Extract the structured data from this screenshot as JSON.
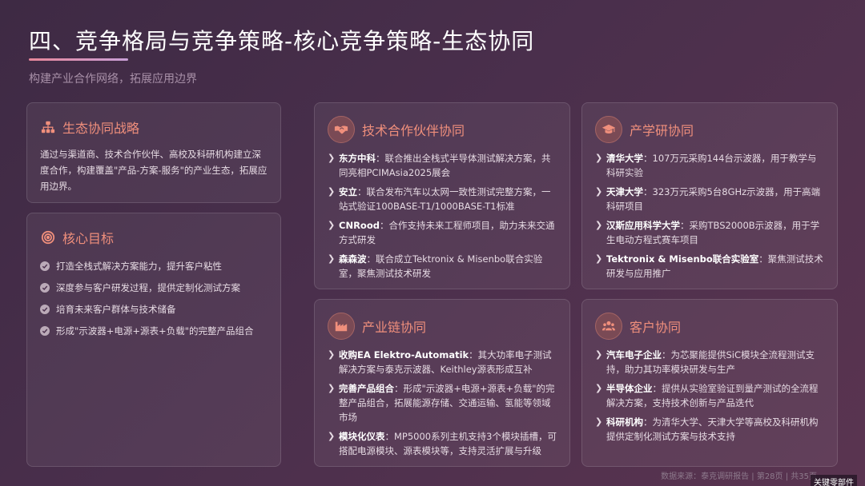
{
  "header": {
    "title": "四、竞争格局与竞争策略-核心竞争策略-生态协同",
    "subtitle": "构建产业合作网络，拓展应用边界"
  },
  "colors": {
    "accent": "#f08f7c",
    "background": "#4a2f4c"
  },
  "strategy": {
    "title": "生态协同战略",
    "icon": "sitemap-icon",
    "description": "通过与渠道商、技术合作伙伴、高校及科研机构建立深度合作，构建覆盖\"产品-方案-服务\"的产业生态，拓展应用边界。"
  },
  "goals": {
    "title": "核心目标",
    "icon": "target-icon",
    "items": [
      "打造全栈式解决方案能力，提升客户粘性",
      "深度参与客户研发过程，提供定制化测试方案",
      "培育未来客户群体与技术储备",
      "形成\"示波器+电源+源表+负载\"的完整产品组合"
    ]
  },
  "tech_partners": {
    "title": "技术合作伙伴协同",
    "icon": "handshake-icon",
    "items": [
      {
        "lead": "东方中科",
        "text": "：联合推出全栈式半导体测试解决方案，共同亮相PCIMAsia2025展会"
      },
      {
        "lead": "安立",
        "text": "：联合发布汽车以太网一致性测试完整方案，一站式验证100BASE-T1/1000BASE-T1标准"
      },
      {
        "lead": "CNRood",
        "text": "：合作支持未来工程师项目，助力未来交通方式研发"
      },
      {
        "lead": "森森波",
        "text": "：联合成立Tektronix & Misenbo联合实验室，聚焦测试技术研发"
      }
    ]
  },
  "academia": {
    "title": "产学研协同",
    "icon": "graduation-cap-icon",
    "items": [
      {
        "lead": "清华大学",
        "text": "：107万元采购144台示波器，用于教学与科研实验"
      },
      {
        "lead": "天津大学",
        "text": "：323万元采购5台8GHz示波器，用于高端科研项目"
      },
      {
        "lead": "汉斯应用科学大学",
        "text": "：采购TBS2000B示波器，用于学生电动方程式赛车项目"
      },
      {
        "lead": "Tektronix & Misenbo联合实验室",
        "text": "：聚焦测试技术研发与应用推广"
      }
    ]
  },
  "supply_chain": {
    "title": "产业链协同",
    "icon": "factory-icon",
    "items": [
      {
        "lead": "收购EA Elektro-Automatik",
        "text": "：其大功率电子测试解决方案与泰克示波器、Keithley源表形成互补"
      },
      {
        "lead": "完善产品组合",
        "text": "：形成\"示波器+电源+源表+负载\"的完整产品组合，拓展能源存储、交通运输、氢能等领域市场"
      },
      {
        "lead": "模块化仪表",
        "text": "：MP5000系列主机支持3个模块插槽，可搭配电源模块、源表模块等，支持灵活扩展与升级"
      }
    ]
  },
  "customers": {
    "title": "客户协同",
    "icon": "users-icon",
    "items": [
      {
        "lead": "汽车电子企业",
        "text": "：为芯聚能提供SiC模块全流程测试支持，助力其功率模块研发与生产"
      },
      {
        "lead": "半导体企业",
        "text": "：提供从实验室验证到量产测试的全流程解决方案，支持技术创新与产品迭代"
      },
      {
        "lead": "科研机构",
        "text": "：为清华大学、天津大学等高校及科研机构提供定制化测试方案与技术支持"
      }
    ]
  },
  "footer": {
    "source": "数据来源：泰克调研报告 | 第28页 | 共35页",
    "watermark": "关键零部件"
  }
}
